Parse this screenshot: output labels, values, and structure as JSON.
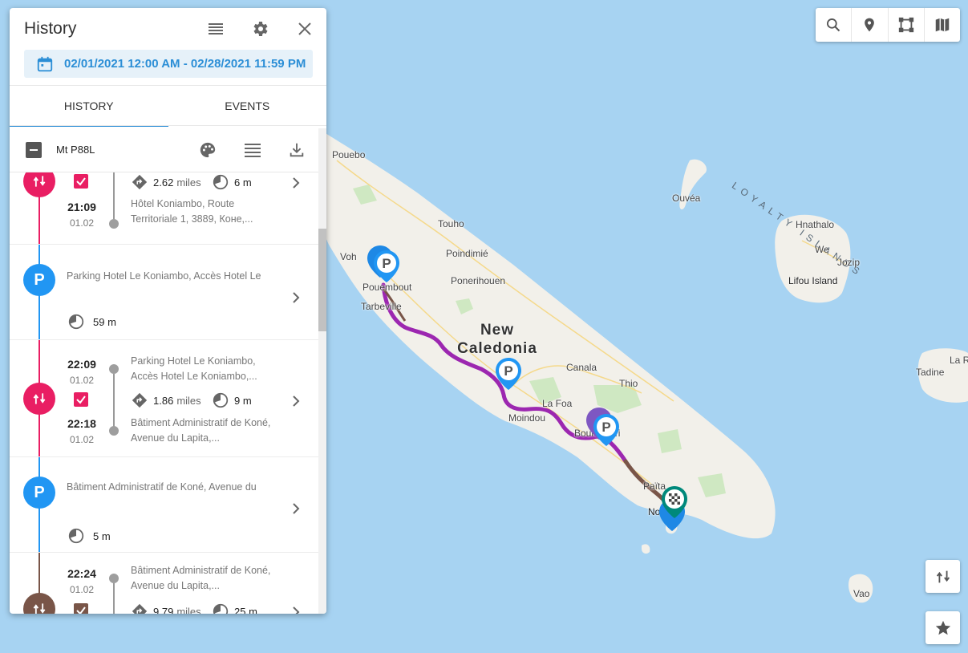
{
  "panel": {
    "title": "History",
    "date_range": "02/01/2021 12:00 AM - 02/28/2021 11:59 PM",
    "tabs": [
      {
        "label": "HISTORY",
        "active": true
      },
      {
        "label": "EVENTS",
        "active": false
      }
    ],
    "device": {
      "name": "Mt P88L",
      "checked": "indeterminate"
    },
    "icons": {
      "list": "list-icon",
      "settings": "gear-icon",
      "close": "close-icon",
      "calendar": "calendar-icon",
      "palette": "palette-icon",
      "download": "download-icon"
    }
  },
  "history": [
    {
      "type": "trip",
      "color": "#e91e63",
      "checked": true,
      "start_time": "21:09",
      "start_date": "01.02",
      "end_address": "Hôtel Koniambo, Route Territoriale 1, 3889, Коне,...",
      "distance": "2.62",
      "distance_unit": "miles",
      "duration": "6 m"
    },
    {
      "type": "parking",
      "color": "#2196f3",
      "address": "Parking Hotel Le Koniambo, Accès Hotel Le",
      "duration": "59 m"
    },
    {
      "type": "trip",
      "color": "#e91e63",
      "checked": true,
      "start_time": "22:09",
      "start_date": "01.02",
      "end_time": "22:18",
      "end_date": "01.02",
      "start_address": "Parking Hotel Le Koniambo, Accès Hotel Le Koniambo,...",
      "end_address": "Bâtiment Administratif de Koné, Avenue du Lapita,...",
      "distance": "1.86",
      "distance_unit": "miles",
      "duration": "9 m"
    },
    {
      "type": "parking",
      "color": "#2196f3",
      "address": "Bâtiment Administratif de Koné, Avenue du",
      "duration": "5 m"
    },
    {
      "type": "trip",
      "color": "#795548",
      "checked": true,
      "start_time": "22:24",
      "start_date": "01.02",
      "start_address": "Bâtiment Administratif de Koné, Avenue du Lapita,...",
      "distance": "9.79",
      "distance_unit": "miles",
      "duration": "25 m"
    }
  ],
  "map": {
    "labels": {
      "pouebo": "Pouebo",
      "ouvea": "Ouvéa",
      "loyalty": "LOYALTY ISLANDS",
      "touho": "Touho",
      "hnathalo": "Hnathalo",
      "we": "We",
      "jozip": "Jozip",
      "lifou": "Lifou Island",
      "poindimie": "Poindimié",
      "ponerihouen": "Ponerihouen",
      "voh": "Voh",
      "pouembout": "Pouembout",
      "tarbeville": "Tarbeville",
      "country_line1": "New",
      "country_line2": "Caledonia",
      "canala": "Canala",
      "thio": "Thio",
      "la_roche": "La Ro",
      "tadine": "Tadine",
      "lafoa": "La Foa",
      "moindou": "Moindou",
      "bouloupari": "Bouloupari",
      "paita": "Païta",
      "noumea": "Nouméa",
      "vao": "Vao"
    },
    "toolbar": [
      "search-icon",
      "location-pin-icon",
      "select-area-icon",
      "map-layers-icon"
    ],
    "floating": [
      "route-icon",
      "star-icon"
    ],
    "route_colors": {
      "purple": "#9c27b0",
      "brown": "#795548",
      "land": "#f2f0ea",
      "sea": "#a7d3f2"
    }
  }
}
